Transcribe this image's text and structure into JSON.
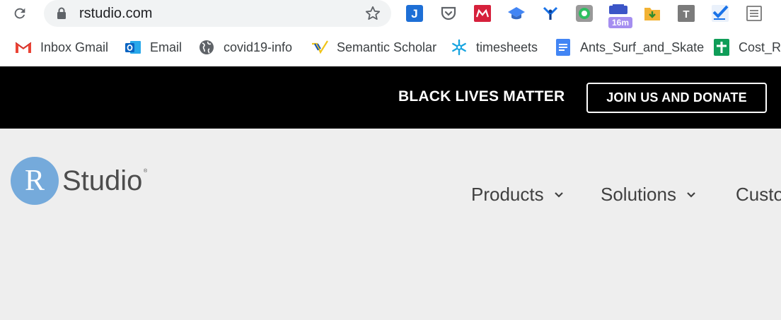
{
  "browser": {
    "url": "rstudio.com",
    "extensions": [
      {
        "name": "J",
        "icon": "jira-icon"
      },
      {
        "name": "pocket",
        "icon": "pocket-icon"
      },
      {
        "name": "mendeley",
        "icon": "mendeley-icon"
      },
      {
        "name": "scholar",
        "icon": "scholar-cap-icon"
      },
      {
        "name": "y",
        "icon": "y-extension-icon"
      },
      {
        "name": "evernote",
        "icon": "evernote-icon"
      },
      {
        "name": "timer",
        "icon": "timer-icon",
        "badge": "16m"
      },
      {
        "name": "download",
        "icon": "folder-download-icon"
      },
      {
        "name": "T",
        "icon": "t-extension-icon"
      },
      {
        "name": "tasks",
        "icon": "checkmark-icon"
      },
      {
        "name": "reader",
        "icon": "reader-icon"
      }
    ]
  },
  "bookmarks": [
    {
      "label": "Inbox Gmail",
      "icon": "gmail-icon"
    },
    {
      "label": "Email",
      "icon": "outlook-icon"
    },
    {
      "label": "covid19-info",
      "icon": "globe-icon"
    },
    {
      "label": "Semantic Scholar",
      "icon": "semantic-scholar-icon"
    },
    {
      "label": "timesheets",
      "icon": "snowflake-icon"
    },
    {
      "label": "Ants_Surf_and_Skate",
      "icon": "docs-icon"
    },
    {
      "label": "Cost_Re",
      "icon": "sheets-icon"
    }
  ],
  "banner": {
    "text": "BLACK LIVES MATTER",
    "button": "JOIN US AND DONATE"
  },
  "site": {
    "logo_letter": "R",
    "logo_text": "Studio",
    "logo_reg": "®",
    "nav": [
      "Products",
      "Solutions",
      "Custo"
    ]
  },
  "colors": {
    "banner_bg": "#000000",
    "logo_blue": "#75aadb",
    "site_bg": "#eeeeee"
  }
}
